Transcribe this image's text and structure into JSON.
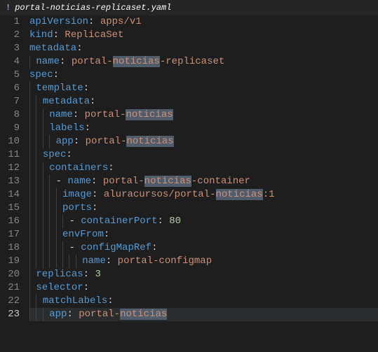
{
  "tab": {
    "icon": "!",
    "filename": "portal-noticias-replicaset.yaml"
  },
  "lines": [
    {
      "n": 1,
      "indent": 0,
      "segs": [
        {
          "t": "apiVersion",
          "c": "key"
        },
        {
          "t": ": ",
          "c": "punct"
        },
        {
          "t": "apps/v1",
          "c": "str"
        }
      ]
    },
    {
      "n": 2,
      "indent": 0,
      "segs": [
        {
          "t": "kind",
          "c": "key"
        },
        {
          "t": ": ",
          "c": "punct"
        },
        {
          "t": "ReplicaSet",
          "c": "str"
        }
      ]
    },
    {
      "n": 3,
      "indent": 0,
      "segs": [
        {
          "t": "metadata",
          "c": "key"
        },
        {
          "t": ":",
          "c": "punct"
        }
      ]
    },
    {
      "n": 4,
      "indent": 1,
      "segs": [
        {
          "t": "name",
          "c": "key"
        },
        {
          "t": ": ",
          "c": "punct"
        },
        {
          "t": "portal-",
          "c": "str"
        },
        {
          "t": "noticias",
          "c": "str",
          "hl": true
        },
        {
          "t": "-replicaset",
          "c": "str"
        }
      ]
    },
    {
      "n": 5,
      "indent": 0,
      "segs": [
        {
          "t": "spec",
          "c": "key"
        },
        {
          "t": ":",
          "c": "punct"
        }
      ]
    },
    {
      "n": 6,
      "indent": 1,
      "segs": [
        {
          "t": "template",
          "c": "key"
        },
        {
          "t": ":",
          "c": "punct"
        }
      ]
    },
    {
      "n": 7,
      "indent": 2,
      "segs": [
        {
          "t": "metadata",
          "c": "key"
        },
        {
          "t": ":",
          "c": "punct"
        }
      ]
    },
    {
      "n": 8,
      "indent": 3,
      "segs": [
        {
          "t": "name",
          "c": "key"
        },
        {
          "t": ": ",
          "c": "punct"
        },
        {
          "t": "portal-",
          "c": "str"
        },
        {
          "t": "noticias",
          "c": "str",
          "hl": true
        }
      ]
    },
    {
      "n": 9,
      "indent": 3,
      "segs": [
        {
          "t": "labels",
          "c": "key"
        },
        {
          "t": ":",
          "c": "punct"
        }
      ]
    },
    {
      "n": 10,
      "indent": 4,
      "segs": [
        {
          "t": "app",
          "c": "key"
        },
        {
          "t": ": ",
          "c": "punct"
        },
        {
          "t": "portal-",
          "c": "str"
        },
        {
          "t": "noticias",
          "c": "str",
          "hl": true
        }
      ]
    },
    {
      "n": 11,
      "indent": 2,
      "segs": [
        {
          "t": "spec",
          "c": "key"
        },
        {
          "t": ":",
          "c": "punct"
        }
      ]
    },
    {
      "n": 12,
      "indent": 3,
      "segs": [
        {
          "t": "containers",
          "c": "key"
        },
        {
          "t": ":",
          "c": "punct"
        }
      ]
    },
    {
      "n": 13,
      "indent": 4,
      "segs": [
        {
          "t": "- ",
          "c": "punct"
        },
        {
          "t": "name",
          "c": "key"
        },
        {
          "t": ": ",
          "c": "punct"
        },
        {
          "t": "portal-",
          "c": "str"
        },
        {
          "t": "noticias",
          "c": "str",
          "hl": true
        },
        {
          "t": "-container",
          "c": "str"
        }
      ]
    },
    {
      "n": 14,
      "indent": 5,
      "segs": [
        {
          "t": "image",
          "c": "key"
        },
        {
          "t": ": ",
          "c": "punct"
        },
        {
          "t": "aluracursos/portal-",
          "c": "str"
        },
        {
          "t": "noticias",
          "c": "str",
          "hl": true
        },
        {
          "t": ":1",
          "c": "str"
        }
      ]
    },
    {
      "n": 15,
      "indent": 5,
      "segs": [
        {
          "t": "ports",
          "c": "key"
        },
        {
          "t": ":",
          "c": "punct"
        }
      ]
    },
    {
      "n": 16,
      "indent": 6,
      "segs": [
        {
          "t": "- ",
          "c": "punct"
        },
        {
          "t": "containerPort",
          "c": "key"
        },
        {
          "t": ": ",
          "c": "punct"
        },
        {
          "t": "80",
          "c": "num"
        }
      ]
    },
    {
      "n": 17,
      "indent": 5,
      "segs": [
        {
          "t": "envFrom",
          "c": "key"
        },
        {
          "t": ":",
          "c": "punct"
        }
      ]
    },
    {
      "n": 18,
      "indent": 6,
      "segs": [
        {
          "t": "- ",
          "c": "punct"
        },
        {
          "t": "configMapRef",
          "c": "key"
        },
        {
          "t": ":",
          "c": "punct"
        }
      ]
    },
    {
      "n": 19,
      "indent": 8,
      "segs": [
        {
          "t": "name",
          "c": "key"
        },
        {
          "t": ": ",
          "c": "punct"
        },
        {
          "t": "portal-configmap",
          "c": "str"
        }
      ]
    },
    {
      "n": 20,
      "indent": 1,
      "segs": [
        {
          "t": "replicas",
          "c": "key"
        },
        {
          "t": ": ",
          "c": "punct"
        },
        {
          "t": "3",
          "c": "num"
        }
      ]
    },
    {
      "n": 21,
      "indent": 1,
      "segs": [
        {
          "t": "selector",
          "c": "key"
        },
        {
          "t": ":",
          "c": "punct"
        }
      ]
    },
    {
      "n": 22,
      "indent": 2,
      "segs": [
        {
          "t": "matchLabels",
          "c": "key"
        },
        {
          "t": ":",
          "c": "punct"
        }
      ]
    },
    {
      "n": 23,
      "indent": 3,
      "segs": [
        {
          "t": "app",
          "c": "key"
        },
        {
          "t": ": ",
          "c": "punct"
        },
        {
          "t": "portal-",
          "c": "str"
        },
        {
          "t": "noticias",
          "c": "str",
          "hl": true
        }
      ],
      "active": true
    }
  ]
}
